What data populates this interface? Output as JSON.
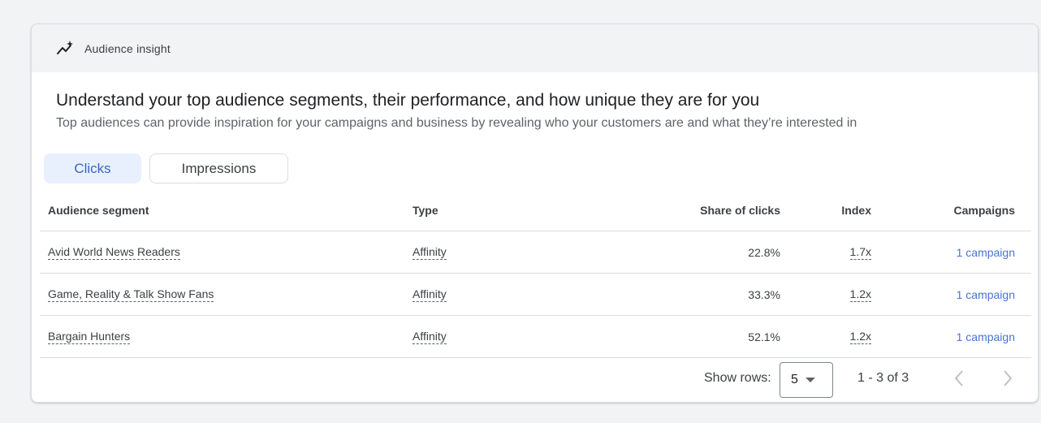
{
  "header": {
    "title": "Audience insight",
    "icon": "trending-sparkle-icon"
  },
  "headline": "Understand your top audience segments, their performance, and how unique they are for you",
  "subline": "Top audiences can provide inspiration for your campaigns and business by revealing who your customers are and what they’re interested in",
  "tabs": [
    {
      "label": "Clicks",
      "active": true
    },
    {
      "label": "Impressions",
      "active": false
    }
  ],
  "table": {
    "columns": {
      "segment": "Audience segment",
      "type": "Type",
      "share": "Share of clicks",
      "index": "Index",
      "campaigns": "Campaigns"
    },
    "rows": [
      {
        "segment": "Avid World News Readers",
        "type": "Affinity",
        "share": "22.8%",
        "index": "1.7x",
        "campaigns": "1 campaign"
      },
      {
        "segment": "Game, Reality & Talk Show Fans",
        "type": "Affinity",
        "share": "33.3%",
        "index": "1.2x",
        "campaigns": "1 campaign"
      },
      {
        "segment": "Bargain Hunters",
        "type": "Affinity",
        "share": "52.1%",
        "index": "1.2x",
        "campaigns": "1 campaign"
      }
    ]
  },
  "pagination": {
    "show_rows_label": "Show rows:",
    "rows_value": "5",
    "range": "1 - 3 of 3"
  },
  "colors": {
    "accent": "#3c64c0",
    "link": "#4a72d3",
    "active_tab_bg": "#e8f0fe",
    "page_bg": "#f1f3f4"
  }
}
